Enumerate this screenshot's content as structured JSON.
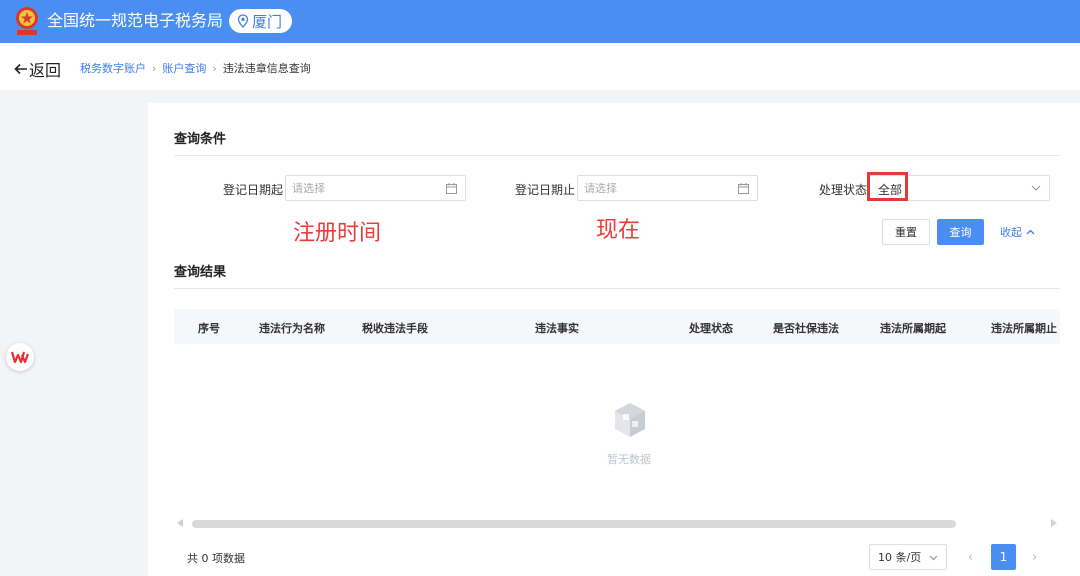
{
  "header": {
    "title": "全国统一规范电子税务局",
    "city": "厦门",
    "icons": {
      "emblem": "tax-emblem-icon",
      "location": "location-pin-icon"
    }
  },
  "nav": {
    "back_label": "返回",
    "breadcrumbs": [
      "税务数字账户",
      "账户查询",
      "违法违章信息查询"
    ]
  },
  "query": {
    "section_title": "查询条件",
    "fields": [
      {
        "label": "登记日期起",
        "placeholder": "请选择"
      },
      {
        "label": "登记日期止",
        "placeholder": "请选择"
      }
    ],
    "status_label": "处理状态",
    "status_value": "全部",
    "annotations": [
      "注册时间",
      "现在"
    ],
    "reset_label": "重置",
    "query_label": "查询",
    "collapse_label": "收起"
  },
  "results": {
    "section_title": "查询结果",
    "columns": [
      "序号",
      "违法行为名称",
      "税收违法手段",
      "违法事实",
      "处理状态",
      "是否社保违法",
      "违法所属期起",
      "违法所属期止"
    ],
    "empty_text": "暂无数据"
  },
  "pagination": {
    "total_text": "共 0 项数据",
    "page_size": "10 条/页",
    "current_page": "1"
  },
  "colors": {
    "primary": "#4a8ef2",
    "annotation": "#ec3b3b",
    "highlight": "#e53935"
  }
}
